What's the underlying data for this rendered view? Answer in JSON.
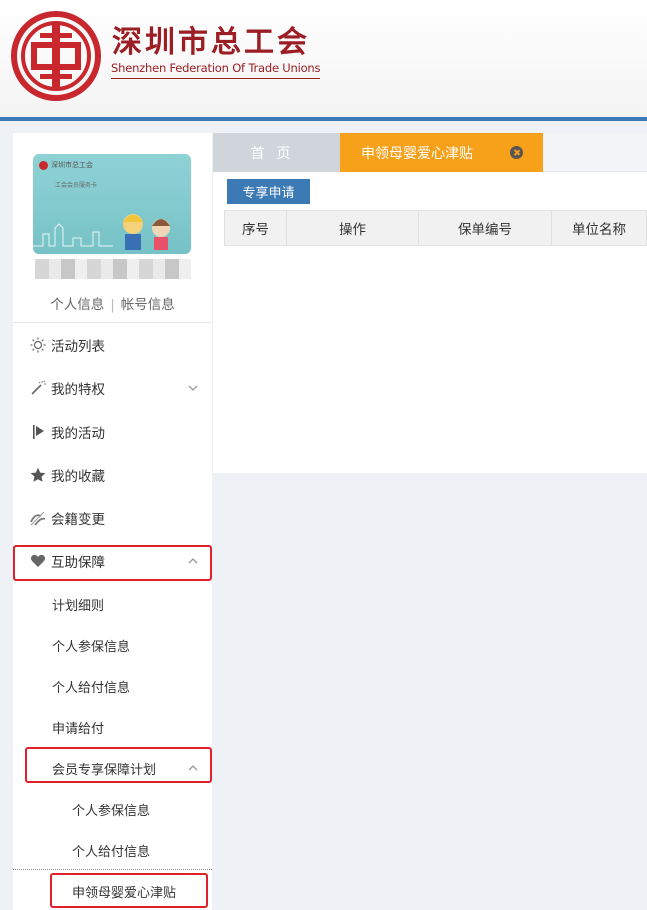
{
  "header": {
    "brand_cn": "深圳市总工会",
    "brand_en": "Shenzhen Federation Of Trade Unions"
  },
  "sidebar": {
    "card": {
      "title": "深圳市总工会",
      "subtitle": "工会会员服务卡"
    },
    "links": {
      "personal_info": "个人信息",
      "account_info": "帐号信息"
    },
    "menu": [
      {
        "label": "活动列表",
        "icon": "sun-icon"
      },
      {
        "label": "我的特权",
        "icon": "magic-wand-icon",
        "chevron": "down"
      },
      {
        "label": "我的活动",
        "icon": "flag-icon"
      },
      {
        "label": "我的收藏",
        "icon": "star-icon"
      },
      {
        "label": "会籍变更",
        "icon": "transfer-icon"
      },
      {
        "label": "互助保障",
        "icon": "heart-icon",
        "chevron": "up"
      }
    ],
    "submenu": [
      {
        "label": "计划细则"
      },
      {
        "label": "个人参保信息"
      },
      {
        "label": "个人给付信息"
      },
      {
        "label": "申请给付"
      },
      {
        "label": "会员专享保障计划",
        "chevron": "up"
      }
    ],
    "submenu_l2": [
      {
        "label": "个人参保信息"
      },
      {
        "label": "个人给付信息"
      },
      {
        "label": "申领母婴爱心津贴"
      }
    ]
  },
  "tabs": {
    "home": "首页",
    "active": "申领母婴爱心津贴"
  },
  "toolbar": {
    "apply_label": "专享申请"
  },
  "table": {
    "columns": [
      "序号",
      "操作",
      "保单编号",
      "单位名称"
    ]
  },
  "colors": {
    "brand_red": "#9b1e24",
    "accent_blue": "#3c7ab5",
    "tab_orange": "#f7a019",
    "highlight_red": "#e0202a"
  }
}
